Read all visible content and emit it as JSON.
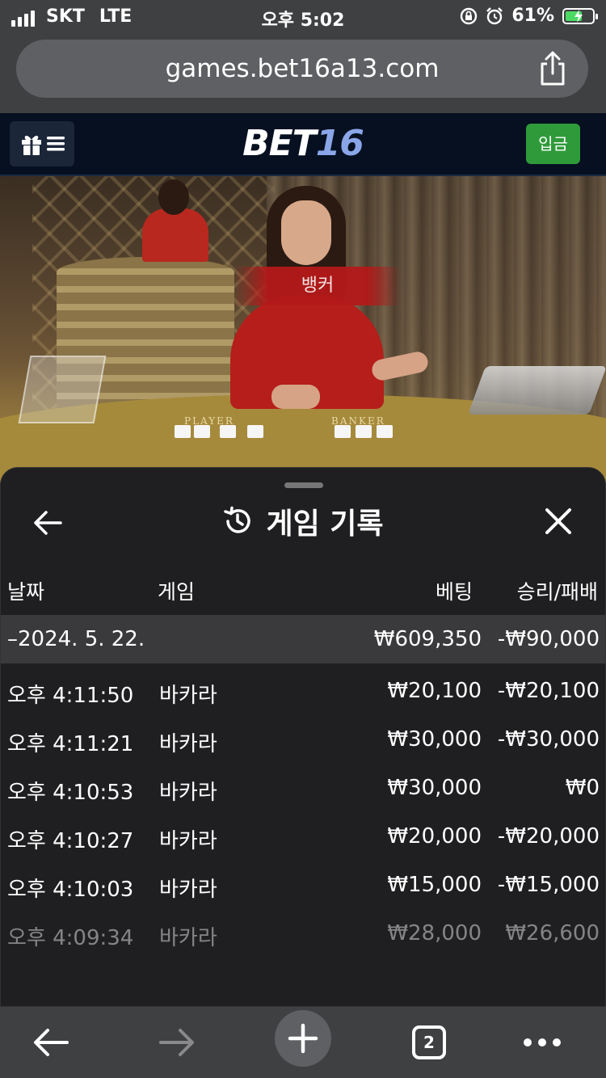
{
  "status_bar": {
    "carrier": "SKT",
    "network": "LTE",
    "time": "오후 5:02",
    "battery_percent": "61%",
    "battery_level": 0.61
  },
  "browser": {
    "url": "games.bet16a13.com",
    "tab_count": "2"
  },
  "site": {
    "logo_part1": "BET",
    "logo_part2": "16",
    "deposit_label": "입금"
  },
  "video": {
    "result_banner": "뱅커",
    "table_label_player": "PLAYER",
    "table_label_banker": "BANKER"
  },
  "history_panel": {
    "title": "게임 기록",
    "columns": {
      "date": "날짜",
      "game": "게임",
      "bet": "베팅",
      "win_loss": "승리/패배"
    },
    "summary": {
      "date": "–2024. 5. 22.",
      "bet": "₩609,350",
      "win_loss": "-₩90,000"
    },
    "rows": [
      {
        "time": "오후 4:11:50",
        "game": "바카라",
        "bet": "₩20,100",
        "win_loss": "-₩20,100"
      },
      {
        "time": "오후 4:11:21",
        "game": "바카라",
        "bet": "₩30,000",
        "win_loss": "-₩30,000"
      },
      {
        "time": "오후 4:10:53",
        "game": "바카라",
        "bet": "₩30,000",
        "win_loss": "₩0"
      },
      {
        "time": "오후 4:10:27",
        "game": "바카라",
        "bet": "₩20,000",
        "win_loss": "-₩20,000"
      },
      {
        "time": "오후 4:10:03",
        "game": "바카라",
        "bet": "₩15,000",
        "win_loss": "-₩15,000"
      },
      {
        "time": "오후 4:09:34",
        "game": "바카라",
        "bet": "₩28,000",
        "win_loss": "₩26,600"
      }
    ]
  },
  "colors": {
    "deposit_green": "#2f9a3a",
    "logo_accent": "#8aa6e8",
    "banner_red": "#b41919"
  },
  "icons": [
    "gift-icon",
    "hamburger-icon",
    "share-icon",
    "back-arrow-icon",
    "history-icon",
    "close-icon",
    "forward-arrow-icon",
    "plus-icon",
    "tabs-icon",
    "more-icon"
  ]
}
